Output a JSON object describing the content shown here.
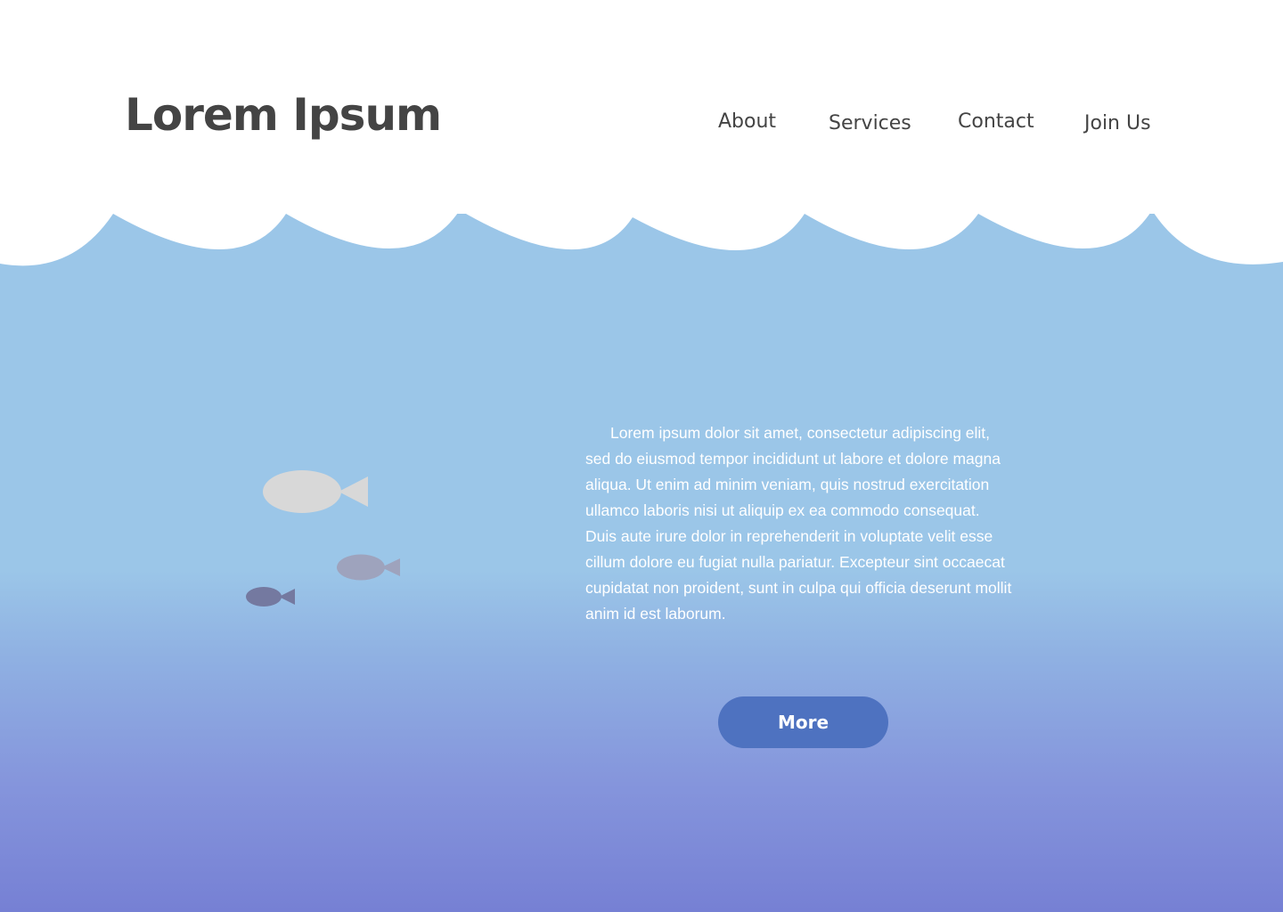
{
  "header": {
    "brand": "Lorem Ipsum",
    "nav": [
      {
        "label": "About"
      },
      {
        "label": "Services"
      },
      {
        "label": "Contact"
      },
      {
        "label": "Join Us"
      }
    ]
  },
  "main": {
    "paragraph": "Lorem ipsum dolor sit amet, consectetur adipiscing elit, sed do eiusmod tempor incididunt ut labore et dolore magna aliqua. Ut enim ad minim veniam, quis nostrud exercitation ullamco laboris nisi ut aliquip ex ea commodo consequat. Duis aute irure dolor in reprehenderit in voluptate velit esse cillum dolore eu fugiat nulla pariatur. Excepteur sint occaecat cupidatat non proident, sunt in culpa qui officia deserunt mollit anim id est laborum.",
    "more_label": "More"
  },
  "colors": {
    "water_top": "#9bc6e8",
    "water_bottom": "#7680d4",
    "button": "#4e72c0",
    "text_dark": "#444444",
    "fish_large": "#d8d8d8",
    "fish_medium": "#9ea3bd",
    "fish_small": "#7479a0"
  },
  "icons": [
    "wave-border",
    "fish-large-icon",
    "fish-medium-icon",
    "fish-small-icon"
  ]
}
